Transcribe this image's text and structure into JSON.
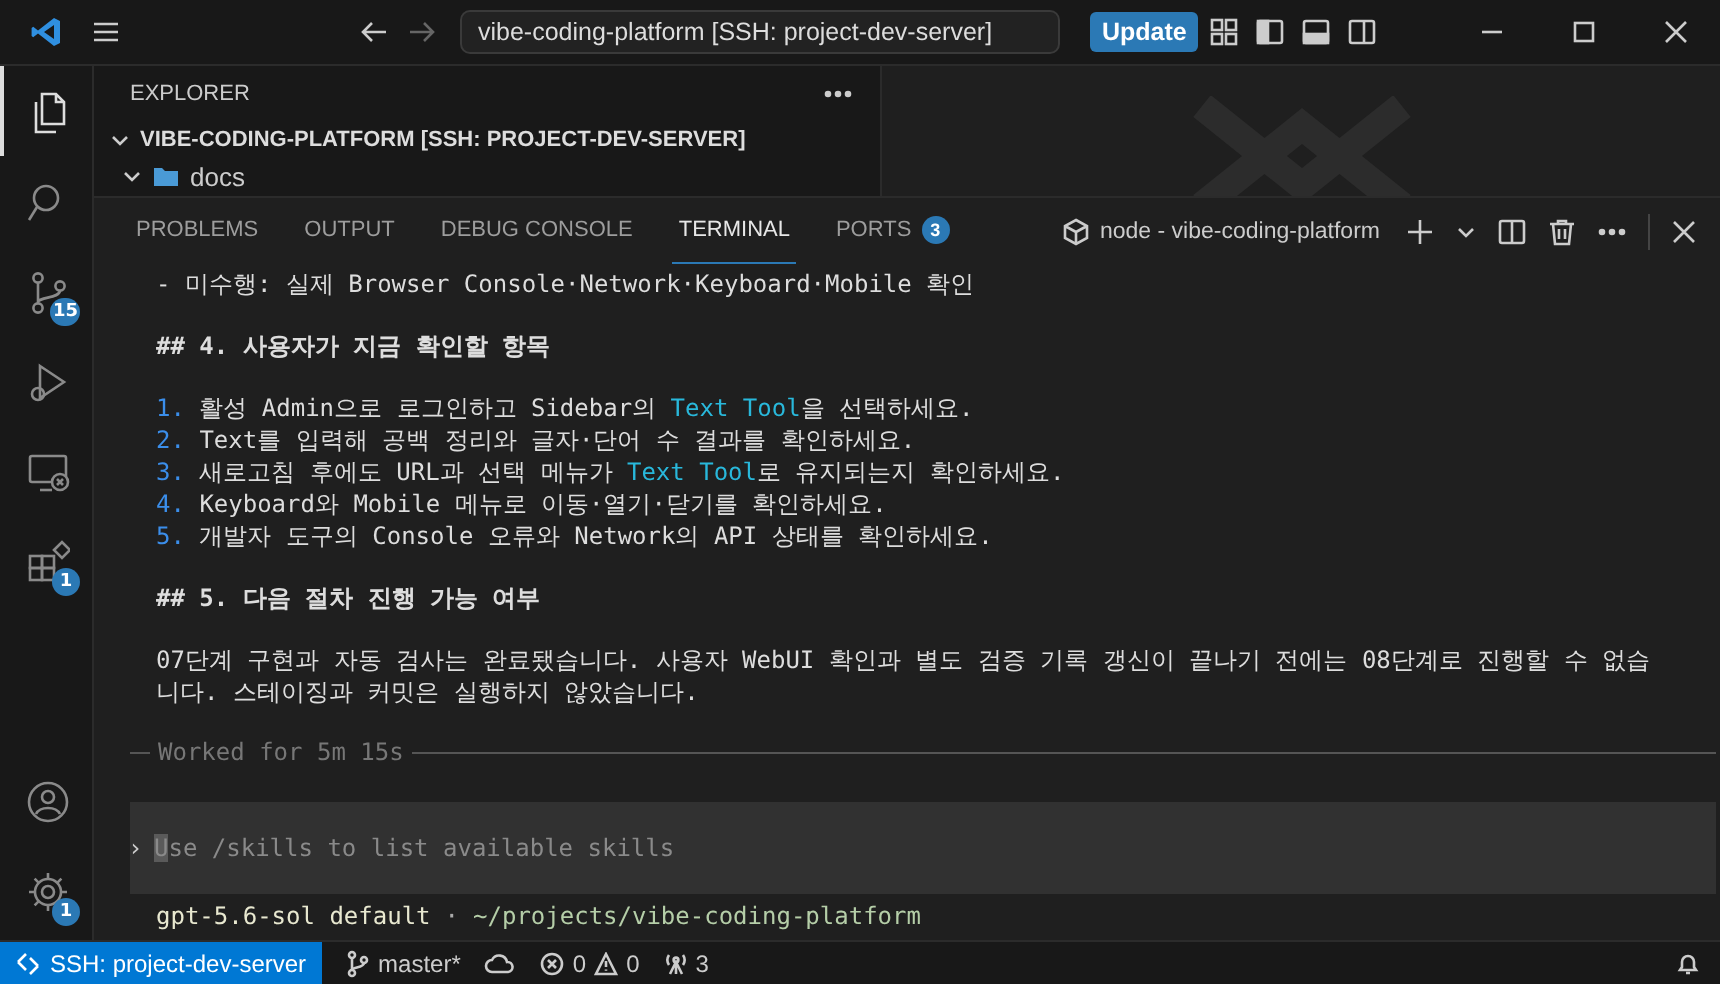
{
  "title_bar": {
    "command_center": "vibe-coding-platform [SSH: project-dev-server]",
    "update_button": "Update"
  },
  "activity_bar": {
    "top": [
      {
        "kind": "files",
        "selected": true
      },
      {
        "kind": "search",
        "selected": false
      },
      {
        "kind": "source-control",
        "selected": false,
        "badge": "15"
      },
      {
        "kind": "run-debug",
        "selected": false
      },
      {
        "kind": "remote",
        "selected": false
      },
      {
        "kind": "extensions",
        "selected": false,
        "badge": "1"
      }
    ],
    "bottom": [
      {
        "kind": "account",
        "selected": false
      },
      {
        "kind": "settings",
        "selected": false,
        "badge": "1"
      }
    ]
  },
  "sidebar": {
    "title": "EXPLORER",
    "root": {
      "label": "VIBE-CODING-PLATFORM [SSH: PROJECT-DEV-SERVER]",
      "expanded": true,
      "children": [
        {
          "label": "docs",
          "expanded": true
        }
      ]
    }
  },
  "panel": {
    "tabs": [
      {
        "label": "PROBLEMS",
        "selected": false
      },
      {
        "label": "OUTPUT",
        "selected": false
      },
      {
        "label": "DEBUG CONSOLE",
        "selected": false
      },
      {
        "label": "TERMINAL",
        "selected": true
      },
      {
        "label": "PORTS",
        "selected": false,
        "badge": "3"
      }
    ],
    "terminal_name": "node - vibe-coding-platform",
    "lines": [
      {
        "kind": "text",
        "segments": [
          {
            "text": "- 미수행: 실제 Browser Console·Network·Keyboard·Mobile 확인",
            "link": false
          }
        ]
      },
      {
        "kind": "heading",
        "segments": [
          {
            "text": "## 4. 사용자가 지금 확인할 항목",
            "link": false
          }
        ]
      },
      {
        "kind": "item",
        "number": "1.",
        "segments": [
          {
            "text": "활성 Admin으로 로그인하고 Sidebar의 ",
            "link": false
          },
          {
            "text": "Text Tool",
            "link": true
          },
          {
            "text": "을 선택하세요.",
            "link": false
          }
        ]
      },
      {
        "kind": "item",
        "number": "2.",
        "segments": [
          {
            "text": "Text를 입력해 공백 정리와 글자·단어 수 결과를 확인하세요.",
            "link": false
          }
        ]
      },
      {
        "kind": "item",
        "number": "3.",
        "segments": [
          {
            "text": "새로고침 후에도 URL과 선택 메뉴가 ",
            "link": false
          },
          {
            "text": "Text Tool",
            "link": true
          },
          {
            "text": "로 유지되는지 확인하세요.",
            "link": false
          }
        ]
      },
      {
        "kind": "item",
        "number": "4.",
        "segments": [
          {
            "text": "Keyboard와 Mobile 메뉴로 이동·열기·닫기를 확인하세요.",
            "link": false
          }
        ]
      },
      {
        "kind": "item",
        "number": "5.",
        "segments": [
          {
            "text": "개발자 도구의 Console 오류와 Network의 API 상태를 확인하세요.",
            "link": false
          }
        ]
      },
      {
        "kind": "heading",
        "segments": [
          {
            "text": "## 5. 다음 절차 진행 가능 여부",
            "link": false
          }
        ]
      },
      {
        "kind": "text",
        "segments": [
          {
            "text": "07단계 구현과 자동 검사는 완료됐습니다. 사용자 WebUI 확인과 별도 검증 기록 갱신이 끝나기 전에는 08단계로 진행할 수 없습니다. 스테이징과 커밋은 실행하지 않았습니다.",
            "link": false
          }
        ]
      }
    ],
    "worked": "Worked for 5m 15s",
    "prompt": "›",
    "input_placeholder": "Use /skills to list available skills",
    "footer": {
      "model": "gpt-5.6-sol default",
      "separator": "·",
      "path": "~/projects/vibe-coding-platform"
    }
  },
  "status_bar": {
    "remote": "SSH: project-dev-server",
    "branch": "master*",
    "errors": "0",
    "warnings": "0",
    "ports": "3"
  }
}
